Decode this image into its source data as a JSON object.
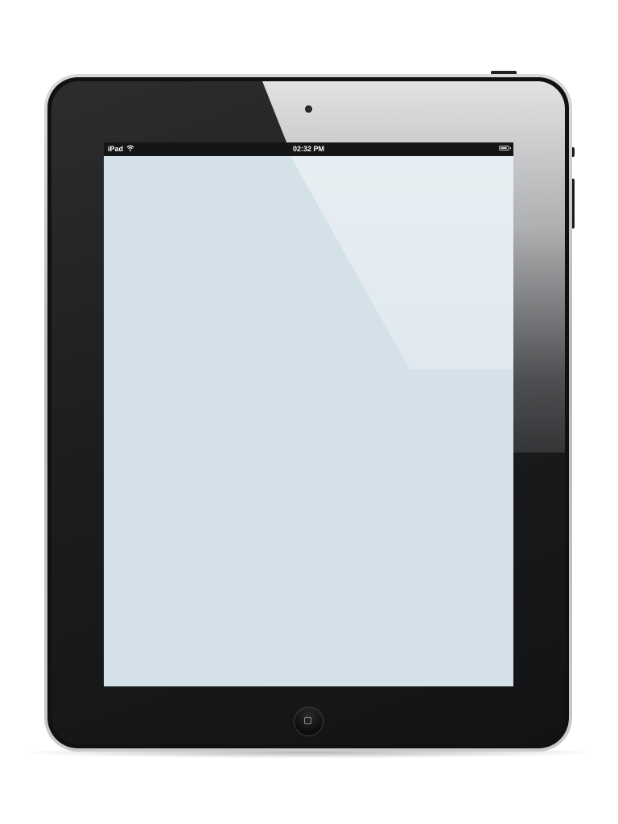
{
  "statusbar": {
    "device_name": "iPad",
    "time": "02:32 PM",
    "battery_level": 0.9
  },
  "icons": {
    "wifi": "wifi-icon",
    "battery": "battery-icon",
    "camera": "camera-icon",
    "home": "home-button-icon"
  },
  "colors": {
    "screen": "#d4e1e9",
    "bezel": "#1c1d1f",
    "statusbar": "#141516",
    "frame": "#c9cacb"
  }
}
